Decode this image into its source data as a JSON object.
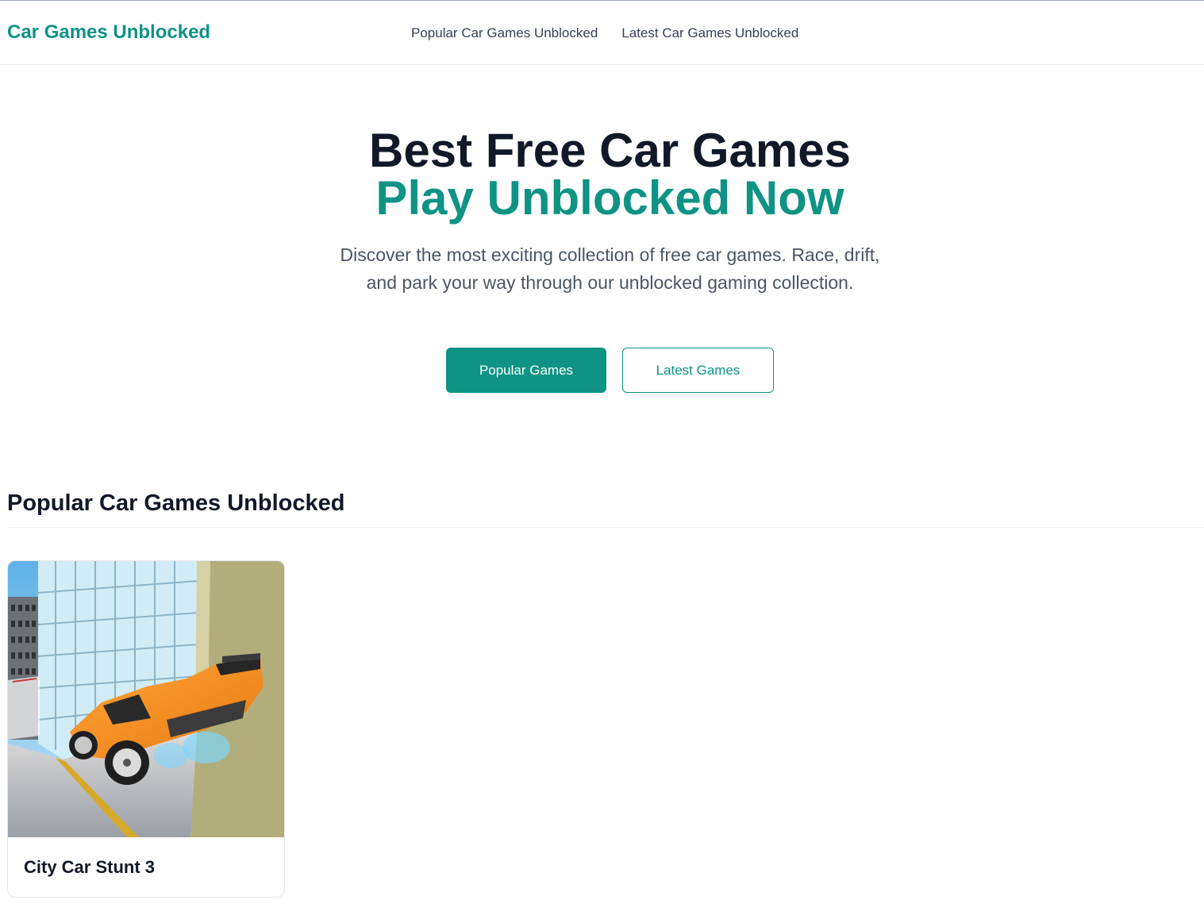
{
  "header": {
    "logo": "Car Games Unblocked",
    "nav": [
      {
        "label": "Popular Car Games Unblocked"
      },
      {
        "label": "Latest Car Games Unblocked"
      }
    ]
  },
  "hero": {
    "title_line1": "Best Free Car Games",
    "title_line2": "Play Unblocked Now",
    "description": "Discover the most exciting collection of free car games. Race, drift, and park your way through our unblocked gaming collection.",
    "primary_button": "Popular Games",
    "secondary_button": "Latest Games"
  },
  "popular": {
    "heading": "Popular Car Games Unblocked",
    "games": [
      {
        "title": "City Car Stunt 3"
      }
    ]
  },
  "colors": {
    "accent": "#0e9384",
    "heading": "#111827",
    "body_text": "#4b5563"
  }
}
